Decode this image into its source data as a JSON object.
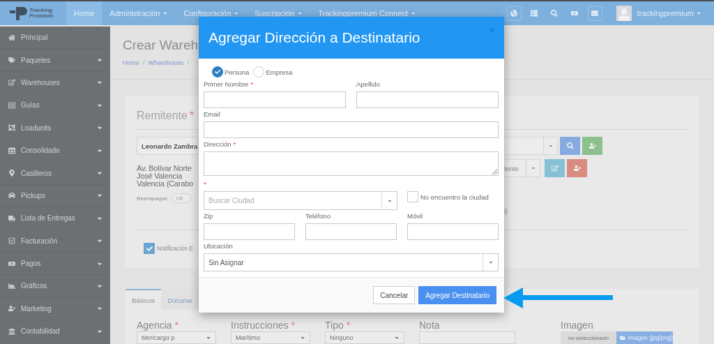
{
  "navbar": {
    "logo_top": "Tracking",
    "logo_bottom": "Premium",
    "menu": [
      {
        "label": "Home",
        "selected": true,
        "has_caret": false
      },
      {
        "label": "Administración",
        "selected": false,
        "has_caret": true
      },
      {
        "label": "Configuración",
        "selected": false,
        "has_caret": true
      },
      {
        "label": "Suscripción",
        "selected": false,
        "has_caret": true
      },
      {
        "label": "Trackingpremium Connect",
        "selected": false,
        "has_caret": true
      }
    ],
    "user": "trackingpremium"
  },
  "sidebar": {
    "items": [
      {
        "label": "Principal",
        "expandable": false
      },
      {
        "label": "Paquetes",
        "expandable": true
      },
      {
        "label": "Warehouses",
        "expandable": true
      },
      {
        "label": "Guías",
        "expandable": true
      },
      {
        "label": "Loadunits",
        "expandable": true
      },
      {
        "label": "Consolidado",
        "expandable": true
      },
      {
        "label": "Casilleros",
        "expandable": true
      },
      {
        "label": "Pickups",
        "expandable": true
      },
      {
        "label": "Lista de Entregas",
        "expandable": true
      },
      {
        "label": "Facturación",
        "expandable": true
      },
      {
        "label": "Pagos",
        "expandable": true
      },
      {
        "label": "Gráficos",
        "expandable": true
      },
      {
        "label": "Marketing",
        "expandable": true
      },
      {
        "label": "Contabilidad",
        "expandable": true
      }
    ]
  },
  "page": {
    "title": "Crear Wareh",
    "breadcrumb": [
      "Home",
      "Wharehouse"
    ],
    "breadcrumb_separator": "/"
  },
  "sender_panel": {
    "title": "Remitente",
    "required_mark": "*",
    "selected_sender": "Leonardo Zambra",
    "address_lines": [
      "Av. Bolívar Norte",
      "José Valencia",
      "Valencia (Carabo"
    ],
    "repack": {
      "label": "Reempaque:",
      "toggle": "Off",
      "on": false
    },
    "type_select": "tente",
    "fragment": "il",
    "notification": {
      "label": "Notificación E",
      "checked": true
    }
  },
  "tabs": [
    {
      "label": "Básicos",
      "selected": true
    },
    {
      "label": "Docume",
      "selected": false
    }
  ],
  "form_fields": [
    {
      "kind": "select",
      "label": "Agencia",
      "required_mark": "*",
      "value": "Mericargo p"
    },
    {
      "kind": "select",
      "label": "Instrucciones",
      "required_mark": "*",
      "value": "Marítimo"
    },
    {
      "kind": "select",
      "label": "Tipo",
      "required_mark": "*",
      "value": "Ninguno"
    },
    {
      "kind": "text",
      "label": "Nota"
    },
    {
      "kind": "file",
      "label": "Imagen",
      "value": "no seleccionado",
      "button": "Imagen (jpg/png)"
    }
  ],
  "modal": {
    "title": "Agregar Dirección a Destinatario",
    "close": "×",
    "entity_types": [
      {
        "label": "Persona",
        "selected": true
      },
      {
        "label": "Empresa",
        "selected": false
      }
    ],
    "first_name": {
      "label": "Primer Nombre",
      "required_mark": "*"
    },
    "last_name": {
      "label": "Apellido"
    },
    "email": {
      "label": "Email"
    },
    "address": {
      "label": "Dirección",
      "required_mark": "*"
    },
    "city": {
      "required_mark": "*",
      "placeholder": "Buscar Ciudad"
    },
    "city_not_found": {
      "label": "No encuentro la ciudad",
      "checked": false
    },
    "zip": {
      "label": "Zip"
    },
    "phone": {
      "label": "Teléfono"
    },
    "mobile": {
      "label": "Móvil"
    },
    "location": {
      "label": "Ubicación",
      "value": "Sin Asignar"
    },
    "cancel": "Cancelar",
    "submit": "Agregar Destinatario"
  }
}
